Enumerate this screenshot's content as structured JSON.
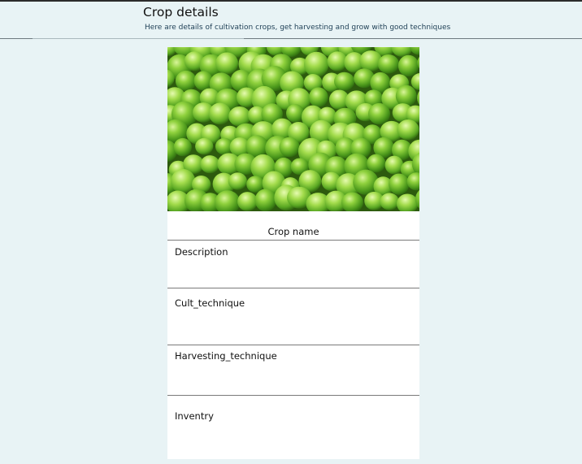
{
  "header": {
    "title": "Crop details",
    "subtitle": "Here are details of cultivation crops, get harvesting and grow with good techniques"
  },
  "card": {
    "image_icon": "green-peas-image",
    "crop_name_label": "Crop name",
    "sections": [
      {
        "label": "Description"
      },
      {
        "label": "Cult_technique"
      },
      {
        "label": "Harvesting_technique"
      },
      {
        "label": "Inventry"
      }
    ]
  }
}
